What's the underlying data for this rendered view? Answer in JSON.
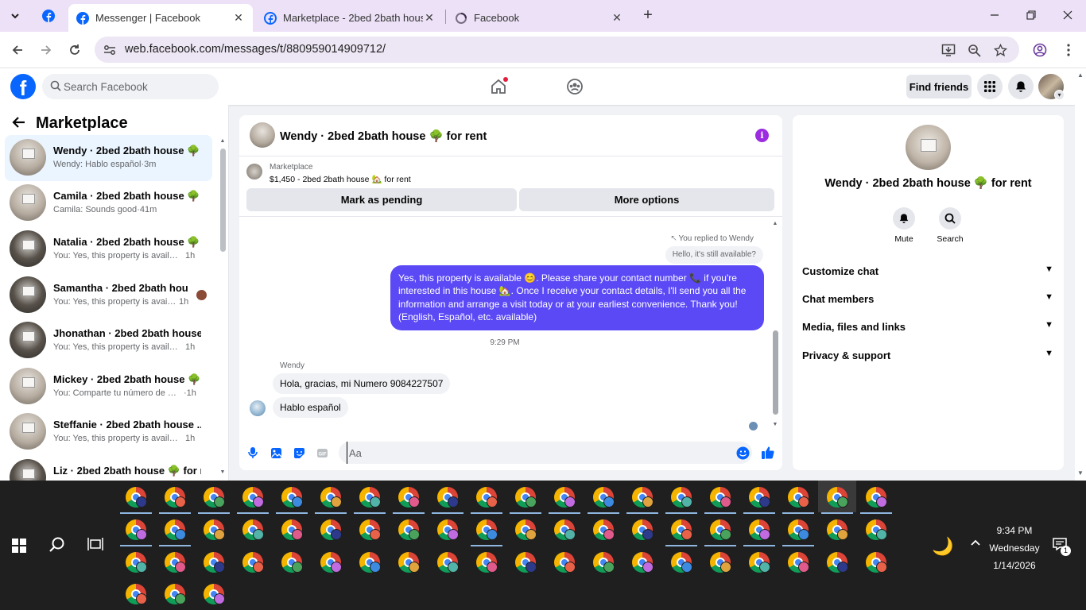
{
  "browser": {
    "tabs": [
      {
        "title": "Messenger | Facebook",
        "active": true
      },
      {
        "title": "Marketplace - 2bed 2bath house",
        "active": false
      },
      {
        "title": "Facebook",
        "active": false
      }
    ],
    "url": "web.facebook.com/messages/t/880959014909712/",
    "icons": {
      "tab_search": "chevron-down-icon",
      "new_tab": "plus-icon",
      "close": "close-icon"
    }
  },
  "fb_header": {
    "logo": "f",
    "search_placeholder": "Search Facebook",
    "find_friends": "Find friends",
    "brand_color": "#0866ff"
  },
  "sidebar": {
    "title": "Marketplace",
    "conversations": [
      {
        "name": "Wendy · 2bed 2bath house 🌳 f...",
        "preview": "Wendy: Hablo español",
        "time": "·3m",
        "active": true
      },
      {
        "name": "Camila · 2bed 2bath house 🌳 f...",
        "preview": "Camila: Sounds good",
        "time": "·41m",
        "active": false
      },
      {
        "name": "Natalia · 2bed 2bath house 🌳 f...",
        "preview": "You: Yes, this property is available ...",
        "time": "1h",
        "active": false
      },
      {
        "name": "Samantha · 2bed 2bath hous...",
        "preview": "You: Yes, this property is availabl...",
        "time": "1h",
        "active": false
      },
      {
        "name": "Jhonathan · 2bed 2bath house ...",
        "preview": "You: Yes, this property is available ...",
        "time": "1h",
        "active": false
      },
      {
        "name": "Mickey · 2bed 2bath house 🌳 f...",
        "preview": "You: Comparte tu número de cont...",
        "time": "·1h",
        "active": false
      },
      {
        "name": "Steffanie · 2bed 2bath house ...",
        "preview": "You: Yes, this property is available ...",
        "time": "1h",
        "active": false
      },
      {
        "name": "Liz · 2bed 2bath house 🌳 for re...",
        "preview": "",
        "time": "",
        "active": false
      }
    ]
  },
  "chat": {
    "title": "Wendy · 2bed 2bath house 🌳 for rent",
    "listing_category": "Marketplace",
    "listing_title": "$1,450 - 2bed 2bath house 🏡 for rent",
    "mark_pending": "Mark as pending",
    "more_options": "More options",
    "reply_note": "You replied to Wendy",
    "reply_quote": "Hello, it's still available?",
    "outgoing_message": "Yes, this property is available 😊. Please share your contact number 📞 if you're interested in this house 🏡. Once I receive your contact details, I'll send you all the information and arrange a visit today or at your earliest convenience. Thank you! (English, Español, etc. available)",
    "timestamp": "9:29 PM",
    "sender": "Wendy",
    "incoming": [
      "Hola, gracias, mi Numero 9084227507",
      "Hablo español"
    ],
    "composer_placeholder": "Aa",
    "accent_color": "#5b49f5"
  },
  "info": {
    "name": "Wendy · 2bed 2bath house 🌳 for rent",
    "mute": "Mute",
    "search": "Search",
    "sections": [
      "Customize chat",
      "Chat members",
      "Media, files and links",
      "Privacy & support"
    ]
  },
  "taskbar": {
    "time": "9:34 PM",
    "day": "Wednesday",
    "date": "1/14/2026",
    "notification_count": "1"
  }
}
